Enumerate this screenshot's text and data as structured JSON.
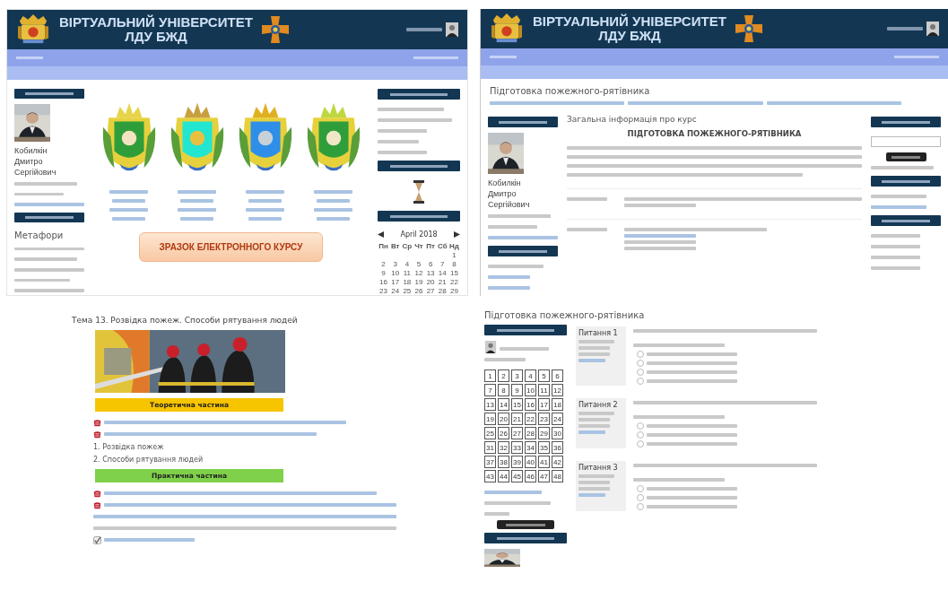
{
  "home_page": {
    "header": {
      "title_lines": [
        "ВІРТУАЛЬНИЙ УНІВЕРСИТЕТ",
        "ЛДУ БЖД"
      ]
    },
    "profile": {
      "name_lines": [
        "Кобилкін",
        "Дмитро",
        "Сергійович"
      ]
    },
    "glossary_term": "Метафори",
    "course_button": "ЗРАЗОК ЕЛЕКТРОННОГО КУРСУ",
    "calendar": {
      "month": "April 2018",
      "weekdays": [
        "Пн",
        "Вт",
        "Ср",
        "Чт",
        "Пт",
        "Сб",
        "Нд"
      ],
      "weeks": [
        [
          "1"
        ],
        [
          "2",
          "3",
          "4",
          "5",
          "6",
          "7",
          "8"
        ],
        [
          "9",
          "10",
          "11",
          "12",
          "13",
          "14",
          "15"
        ],
        [
          "16",
          "17",
          "18",
          "19",
          "20",
          "21",
          "22"
        ],
        [
          "23",
          "24",
          "25",
          "26",
          "27",
          "28",
          "29"
        ]
      ]
    }
  },
  "course_page": {
    "header": {
      "title_lines": [
        "ВІРТУАЛЬНИЙ УНІВЕРСИТЕТ",
        "ЛДУ БЖД"
      ]
    },
    "page_title": "Підготовка пожежного-рятівника",
    "profile": {
      "name_lines": [
        "Кобилкін",
        "Дмитро",
        "Сергійович"
      ]
    },
    "section_title": "Загальна інформація про курс",
    "course_title": "ПІДГОТОВКА ПОЖЕЖНОГО-РЯТІВНИКА"
  },
  "topic_page": {
    "title": "Тема 13. Розвідка пожеж. Способи рятування людей",
    "theory_banner": "Теоретична частина",
    "topics": [
      "1. Розвідка пожеж",
      "2. Способи рятування людей"
    ],
    "practice_banner": "Практична частина"
  },
  "quiz_page": {
    "page_title": "Підготовка пожежного-рятівника",
    "question_numbers": [
      "1",
      "2",
      "3",
      "4",
      "5",
      "6",
      "7",
      "8",
      "9",
      "10",
      "11",
      "12",
      "13",
      "14",
      "15",
      "16",
      "17",
      "18",
      "19",
      "20",
      "21",
      "22",
      "23",
      "24",
      "25",
      "26",
      "27",
      "28",
      "29",
      "30",
      "31",
      "32",
      "33",
      "34",
      "35",
      "36",
      "37",
      "38",
      "39",
      "40",
      "41",
      "42",
      "43",
      "44",
      "45",
      "46",
      "47",
      "48"
    ],
    "questions": [
      {
        "label": "Питання 1",
        "options": [
          {
            "selected": false
          },
          {
            "selected": false
          },
          {
            "selected": false
          },
          {
            "selected": false
          }
        ]
      },
      {
        "label": "Питання 2",
        "options": [
          {
            "selected": false
          },
          {
            "selected": false
          },
          {
            "selected": false
          }
        ]
      },
      {
        "label": "Питання 3",
        "options": [
          {
            "selected": false
          },
          {
            "selected": false
          },
          {
            "selected": false
          }
        ]
      }
    ]
  }
}
